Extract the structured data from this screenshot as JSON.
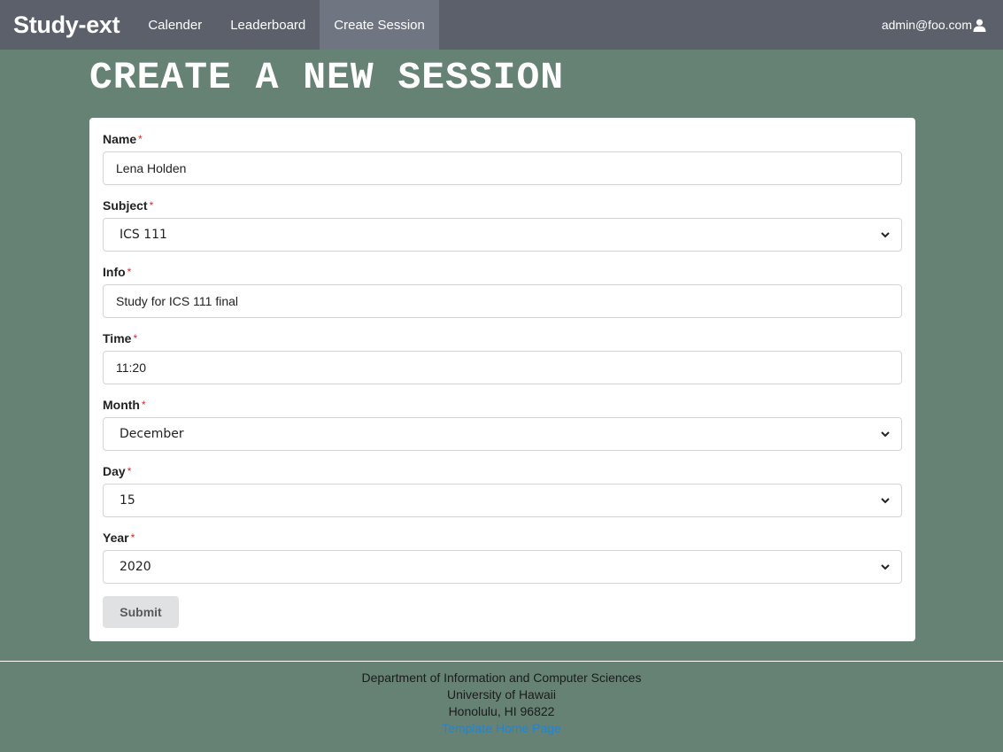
{
  "navbar": {
    "brand": "Study-ext",
    "items": [
      {
        "label": "Calender",
        "active": false
      },
      {
        "label": "Leaderboard",
        "active": false
      },
      {
        "label": "Create Session",
        "active": true
      }
    ],
    "user": "admin@foo.com",
    "user_icon": "user-icon"
  },
  "page": {
    "title": "CREATE A NEW SESSION"
  },
  "form": {
    "required_mark": "*",
    "name": {
      "label": "Name",
      "value": "Lena Holden"
    },
    "subject": {
      "label": "Subject",
      "value": "ICS 111"
    },
    "info": {
      "label": "Info",
      "value": "Study for ICS 111 final"
    },
    "time": {
      "label": "Time",
      "value": "11:20"
    },
    "month": {
      "label": "Month",
      "value": "December"
    },
    "day": {
      "label": "Day",
      "value": "15"
    },
    "year": {
      "label": "Year",
      "value": "2020"
    },
    "submit_label": "Submit"
  },
  "footer": {
    "line1": "Department of Information and Computer Sciences",
    "line2": "University of Hawaii",
    "line3": "Honolulu, HI 96822",
    "link": "Template Home Page"
  },
  "colors": {
    "background": "#668275",
    "navbar": "#5c606a",
    "navbar_active": "#707582",
    "link": "#2185d0",
    "required": "#db2828"
  }
}
